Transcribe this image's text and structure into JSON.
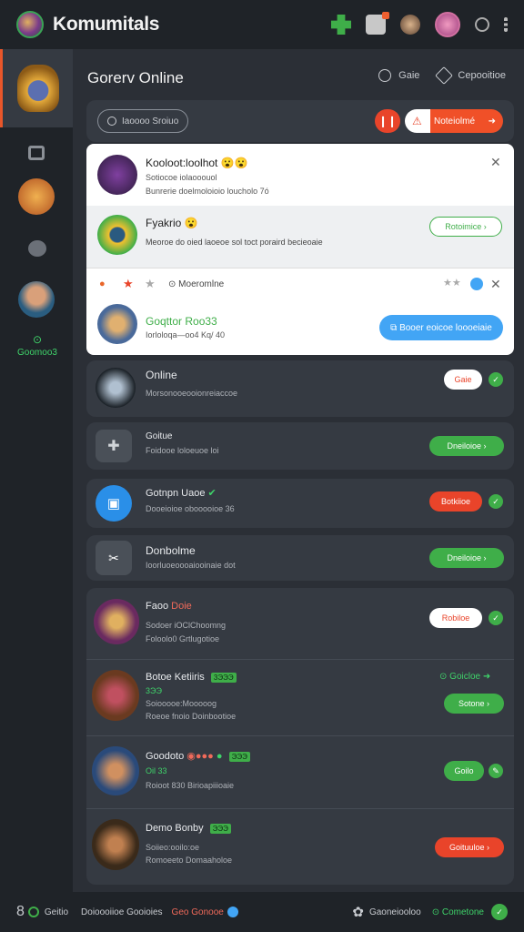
{
  "header": {
    "app_title": "Komumitals"
  },
  "main": {
    "title": "Gorerv Online",
    "link1": "Gaie",
    "link2": "Cepooitioe",
    "search_placeholder": "Iaoooo Sroiuo",
    "notif_label": "Noteiolmé"
  },
  "popup": {
    "row1": {
      "name": "Kooloot:loolhot 😮😮",
      "line1": "Sotiocoe iolaooouol",
      "line2": "Bunrerie doelmoloioio loucholo 7ó"
    },
    "row2": {
      "name": "Fyakrio 😮",
      "line1": "Meoroe do oied laoeoe sol toct poraird becieoaie",
      "button": "Rotoimice"
    },
    "row3": {
      "header": "Moeromlne",
      "name": "Goqttor Roo33",
      "line1": "Iorloloqa—oo4 Kq/ 40",
      "button": "Booer eoicoe loooeiaie"
    }
  },
  "list": [
    {
      "name": "Online",
      "sub": "Morsonooeooionreiaccoe",
      "button": "Gaie"
    },
    {
      "name": "Goitue",
      "sub": "Foidooe loloeuoe loi",
      "button": "Dneiloioe"
    },
    {
      "name": "Gotnpn Uaoe",
      "sub": "Dooeioioe obooooioe 36",
      "button": "Botkiioe"
    },
    {
      "name": "Donbolme",
      "sub": "Ioorluoeoooaiooinaie dot",
      "button": "Dneiloioe"
    }
  ],
  "group": [
    {
      "name": "Faoo",
      "tag": "Doie",
      "line1": "Sodoer iOClChoomng",
      "line2": "Foloolo0 Grtlugotioe",
      "button": "Robiloe"
    },
    {
      "name": "Botoe Ketiiris",
      "tag": "3ЭЭЭ",
      "count": "3ЭЭ",
      "line1": "Soiooooe:Mooooog",
      "line2": "Roeoe fnoio Doinbootioe",
      "top_label": "Goicloe",
      "button": "Sotone"
    },
    {
      "name": "Goodoto",
      "tag": "ЭЭЭ",
      "count": "Oil 33",
      "line1": "Roioot 830 Birioapiiioaie",
      "button": "Goilo"
    },
    {
      "name": "Demo Bonby",
      "tag": "ЭЭЭ",
      "line1": "Soiieo:ooilo:oe",
      "line2": "Romoeeto Domaaholoe",
      "button": "Goituuloe"
    }
  ],
  "footer": {
    "item1": "Geitio",
    "item2": "Doioooiioe Gooioies",
    "item3": "Geo Gonooe",
    "item4": "Gaoneiooloo",
    "item5": "Cometone"
  },
  "sidebar": {
    "online_label": "Goomoo3"
  },
  "colors": {
    "accent_red": "#e9442a",
    "accent_green": "#3fae49",
    "accent_blue": "#42a5f5"
  }
}
